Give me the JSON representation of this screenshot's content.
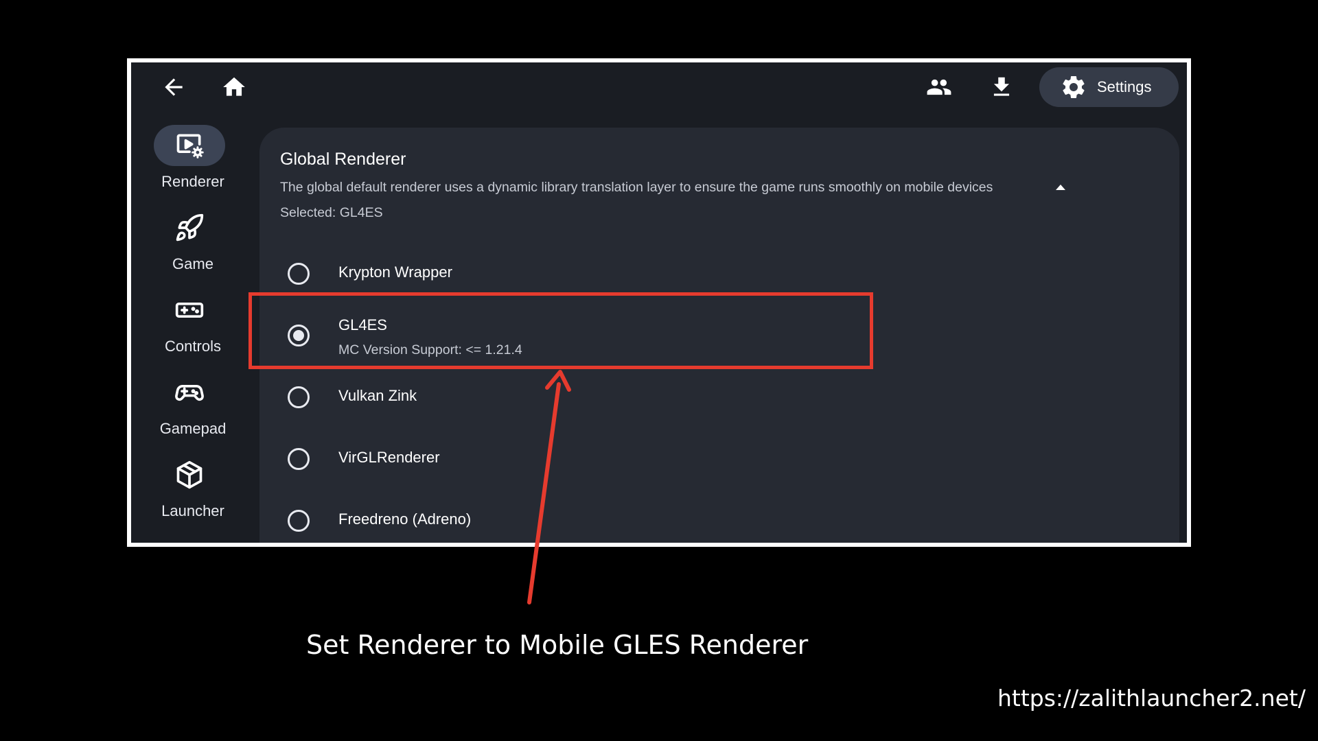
{
  "topbar": {
    "back_icon": "arrow-left-icon",
    "home_icon": "home-icon",
    "accounts_icon": "people-icon",
    "download_icon": "download-icon",
    "settings_label": "Settings",
    "settings_icon": "gear-icon"
  },
  "sidebar": {
    "items": [
      {
        "label": "Renderer",
        "icon": "renderer-video-settings-icon",
        "active": true
      },
      {
        "label": "Game",
        "icon": "rocket-icon",
        "active": false
      },
      {
        "label": "Controls",
        "icon": "keyboard-controls-icon",
        "active": false
      },
      {
        "label": "Gamepad",
        "icon": "gamepad-icon",
        "active": false
      },
      {
        "label": "Launcher",
        "icon": "cube-box-icon",
        "active": false
      }
    ]
  },
  "renderer_section": {
    "title": "Global Renderer",
    "description": "The global default renderer uses a dynamic library translation layer to ensure the game runs smoothly on mobile devices",
    "selected_text": "Selected: GL4ES",
    "options": [
      {
        "label": "Krypton Wrapper",
        "checked": false
      },
      {
        "label": "GL4ES",
        "subtitle": "MC Version Support: <= 1.21.4",
        "checked": true
      },
      {
        "label": "Vulkan Zink",
        "checked": false
      },
      {
        "label": "VirGLRenderer",
        "checked": false
      },
      {
        "label": "Freedreno (Adreno)",
        "checked": false
      }
    ]
  },
  "annotation": {
    "caption": "Set Renderer to Mobile GLES Renderer",
    "url": "https://zalithlauncher2.net/",
    "highlight_color": "#e63b2e"
  },
  "colors": {
    "page_background": "#000000",
    "app_background": "#1a1d23",
    "panel_background": "#262a33",
    "active_pill": "#3c4455"
  }
}
